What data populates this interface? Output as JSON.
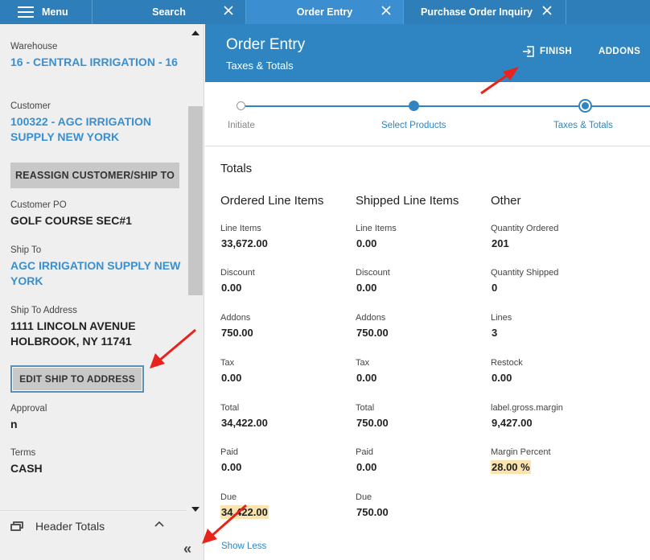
{
  "tabs": {
    "menu": "Menu",
    "search": "Search",
    "order_entry": "Order Entry",
    "purchase_order_inquiry": "Purchase Order Inquiry"
  },
  "sidebar": {
    "warehouse_label": "Warehouse",
    "warehouse_value": "16 - CENTRAL IRRIGATION - 16",
    "customer_label": "Customer",
    "customer_value": "100322 - AGC IRRIGATION SUPPLY NEW YORK",
    "reassign_button": "REASSIGN CUSTOMER/SHIP TO",
    "customer_po_label": "Customer PO",
    "customer_po_value": "GOLF COURSE SEC#1",
    "ship_to_label": "Ship To",
    "ship_to_value": "AGC IRRIGATION SUPPLY NEW YORK",
    "ship_to_address_label": "Ship To Address",
    "ship_to_address_line1": "1111 LINCOLN AVENUE",
    "ship_to_address_line2": "HOLBROOK, NY 11741",
    "edit_ship_button": "EDIT SHIP TO ADDRESS",
    "approval_label": "Approval",
    "approval_value": "n",
    "terms_label": "Terms",
    "terms_value": "CASH",
    "header_totals": "Header Totals",
    "collapse_glyph": "«"
  },
  "header": {
    "title": "Order Entry",
    "subtitle": "Taxes & Totals",
    "finish": "FINISH",
    "addons": "ADDONS"
  },
  "stepper": {
    "steps": [
      "Initiate",
      "Select Products",
      "Taxes & Totals"
    ]
  },
  "totals": {
    "title": "Totals",
    "ordered": {
      "heading": "Ordered Line Items",
      "rows": [
        {
          "label": "Line Items",
          "value": "33,672.00"
        },
        {
          "label": "Discount",
          "value": "0.00"
        },
        {
          "label": "Addons",
          "value": "750.00"
        },
        {
          "label": "Tax",
          "value": "0.00"
        },
        {
          "label": "Total",
          "value": "34,422.00"
        },
        {
          "label": "Paid",
          "value": "0.00"
        },
        {
          "label": "Due",
          "value": "34,422.00"
        }
      ]
    },
    "shipped": {
      "heading": "Shipped Line Items",
      "rows": [
        {
          "label": "Line Items",
          "value": "0.00"
        },
        {
          "label": "Discount",
          "value": "0.00"
        },
        {
          "label": "Addons",
          "value": "750.00"
        },
        {
          "label": "Tax",
          "value": "0.00"
        },
        {
          "label": "Total",
          "value": "750.00"
        },
        {
          "label": "Paid",
          "value": "0.00"
        },
        {
          "label": "Due",
          "value": "750.00"
        }
      ]
    },
    "other": {
      "heading": "Other",
      "rows": [
        {
          "label": "Quantity Ordered",
          "value": "201"
        },
        {
          "label": "Quantity Shipped",
          "value": "0"
        },
        {
          "label": "Lines",
          "value": "3"
        },
        {
          "label": "Restock",
          "value": "0.00"
        },
        {
          "label": "label.gross.margin",
          "value": "9,427.00"
        },
        {
          "label": "Margin Percent",
          "value": "28.00 %"
        }
      ]
    },
    "show_less": "Show Less"
  },
  "colors": {
    "primary": "#2f85c1",
    "topbar": "#2e7fb9",
    "highlight": "#fbe3b0",
    "annotation_arrow": "#e8231c"
  }
}
